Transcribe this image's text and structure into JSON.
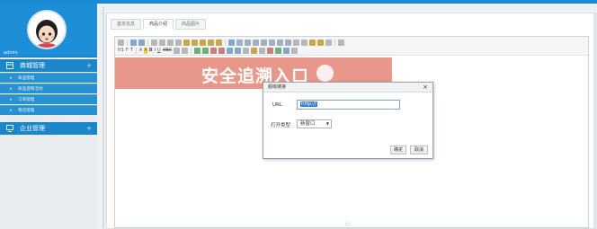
{
  "sidebar": {
    "username": "admin",
    "sections": [
      {
        "label": "商城管理",
        "expand_symbol": "+",
        "items": [
          "商品管理",
          "商品促销活动",
          "订单管理",
          "物流管理"
        ]
      },
      {
        "label": "企业管理",
        "expand_symbol": "+"
      }
    ]
  },
  "tabs": [
    "基本信息",
    "商品介绍",
    "商品图片"
  ],
  "active_tab": 1,
  "editor": {
    "toolbar_text": {
      "heading": "H1",
      "font_family": "F",
      "font_size": "T",
      "font_color": "A",
      "bg_color": "A",
      "bold": "B",
      "italic": "I",
      "underline": "U",
      "strike": "ABC"
    },
    "banner_text": "安全追溯入口",
    "banner_color": "#e8978b",
    "resize_handle": "◇"
  },
  "dialog": {
    "title": "超级链接",
    "close_symbol": "×",
    "url_label": "URL",
    "url_value": "http://",
    "target_label": "打开类型",
    "target_value": "新窗口",
    "confirm_label": "确定",
    "cancel_label": "取消"
  },
  "colors": {
    "accent": "#1e8fd6",
    "sidebar_menu": "#1c86c9"
  }
}
